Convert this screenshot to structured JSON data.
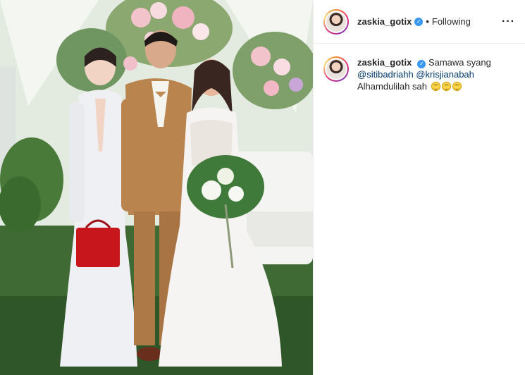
{
  "post": {
    "photo_alt": "Wedding photo of three people in front of a floral backdrop",
    "author": {
      "username": "zaskia_gotix",
      "verified": true,
      "follow_state": "Following"
    },
    "caption": {
      "username": "zaskia_gotix",
      "text": "Samawa syang",
      "mentions": [
        "@sitibadriahh",
        "@krisjianabah"
      ],
      "text2": "Alhamdulilah sah",
      "emojis": [
        "smiling-face-with-halo",
        "smiling-face-with-halo",
        "smiling-face-with-halo"
      ]
    },
    "icons": {
      "more": "more-options-icon",
      "verified": "verified-badge-icon"
    }
  },
  "colors": {
    "link": "#00376b",
    "verified": "#3897f0",
    "text": "#262626",
    "border": "#efefef"
  }
}
